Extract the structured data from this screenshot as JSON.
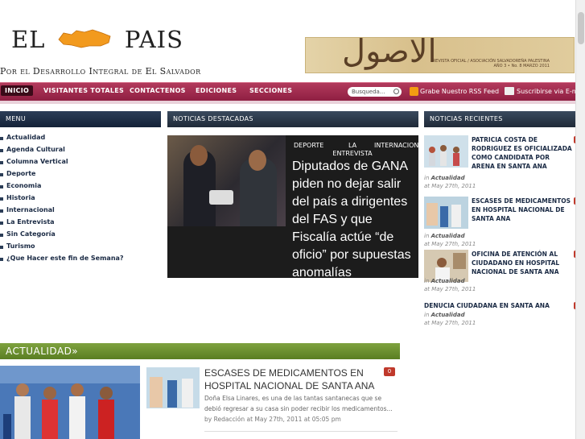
{
  "site": {
    "logo_left": "EL",
    "logo_right": "PAIS",
    "tagline": "Por el Desarrollo Integral de El Salvador"
  },
  "banner": {
    "arabic": "الأصول",
    "caption_1": "REVISTA OFICIAL / ASOCIACIÓN SALVADOREÑA PALESTINA",
    "caption_2": "AÑO 3 • No. 8 MARZO 2011"
  },
  "nav": {
    "items": [
      "Inicio",
      "Visitantes Totales",
      "Contactenos",
      "Ediciones",
      "Secciones"
    ],
    "search_placeholder": "Busqueda...",
    "rss_label": "Grabe Nuestro RSS Feed",
    "subscribe_label": "Suscribirse via E-mai"
  },
  "menu": {
    "title": "Menu",
    "items": [
      "Actualidad",
      "Agenda Cultural",
      "Columna Vertical",
      "Deporte",
      "Economia",
      "Historia",
      "Internacional",
      "La Entrevista",
      "Sin Categoría",
      "Turismo",
      "¿Que Hacer este fin de Semana?"
    ]
  },
  "featured": {
    "title_bar": "Noticias Destacadas",
    "tags": [
      "DEPORTE",
      "LA ENTREVISTA",
      "INTERNACIONA"
    ],
    "headline": "Diputados de GANA piden no dejar salir del país a dirigentes del FAS y que Fiscalía actúe “de oficio” por supuestas anomalías"
  },
  "recent": {
    "title_bar": "Noticias Recientes",
    "items": [
      {
        "title": "PATRICIA COSTA DE RODRIGUEZ ES OFICIALIZADA COMO CANDIDATA POR ARENA EN SANTA ANA",
        "category": "Actualidad",
        "date": "at May 27th, 2011",
        "in": "in"
      },
      {
        "title": "ESCASES DE MEDICAMENTOS EN HOSPITAL NACIONAL DE SANTA ANA",
        "category": "Actualidad",
        "date": "at May 27th, 2011",
        "in": "in"
      },
      {
        "title": "OFICINA DE ATENCIÓN AL CIUDADANO EN HOSPITAL NACIONAL DE SANTA ANA",
        "category": "Actualidad",
        "date": "at May 27th, 2011",
        "in": "in"
      },
      {
        "title": "DENUCIA CIUDADANA EN SANTA ANA",
        "category": "Actualidad",
        "date": "at May 27th, 2011",
        "in": "in"
      }
    ]
  },
  "actualidad": {
    "title": "ACTUALIDAD»",
    "article_title": "ESCASES DE MEDICAMENTOS EN HOSPITAL NACIONAL DE SANTA ANA",
    "comments": "0",
    "excerpt": "Doña Elsa Linares, es una de las tantas santanecas que se debió regresar a su casa sin poder recibir  los medicamentos...",
    "meta": "by Redacción at May 27th, 2011 at 05:05 pm"
  }
}
